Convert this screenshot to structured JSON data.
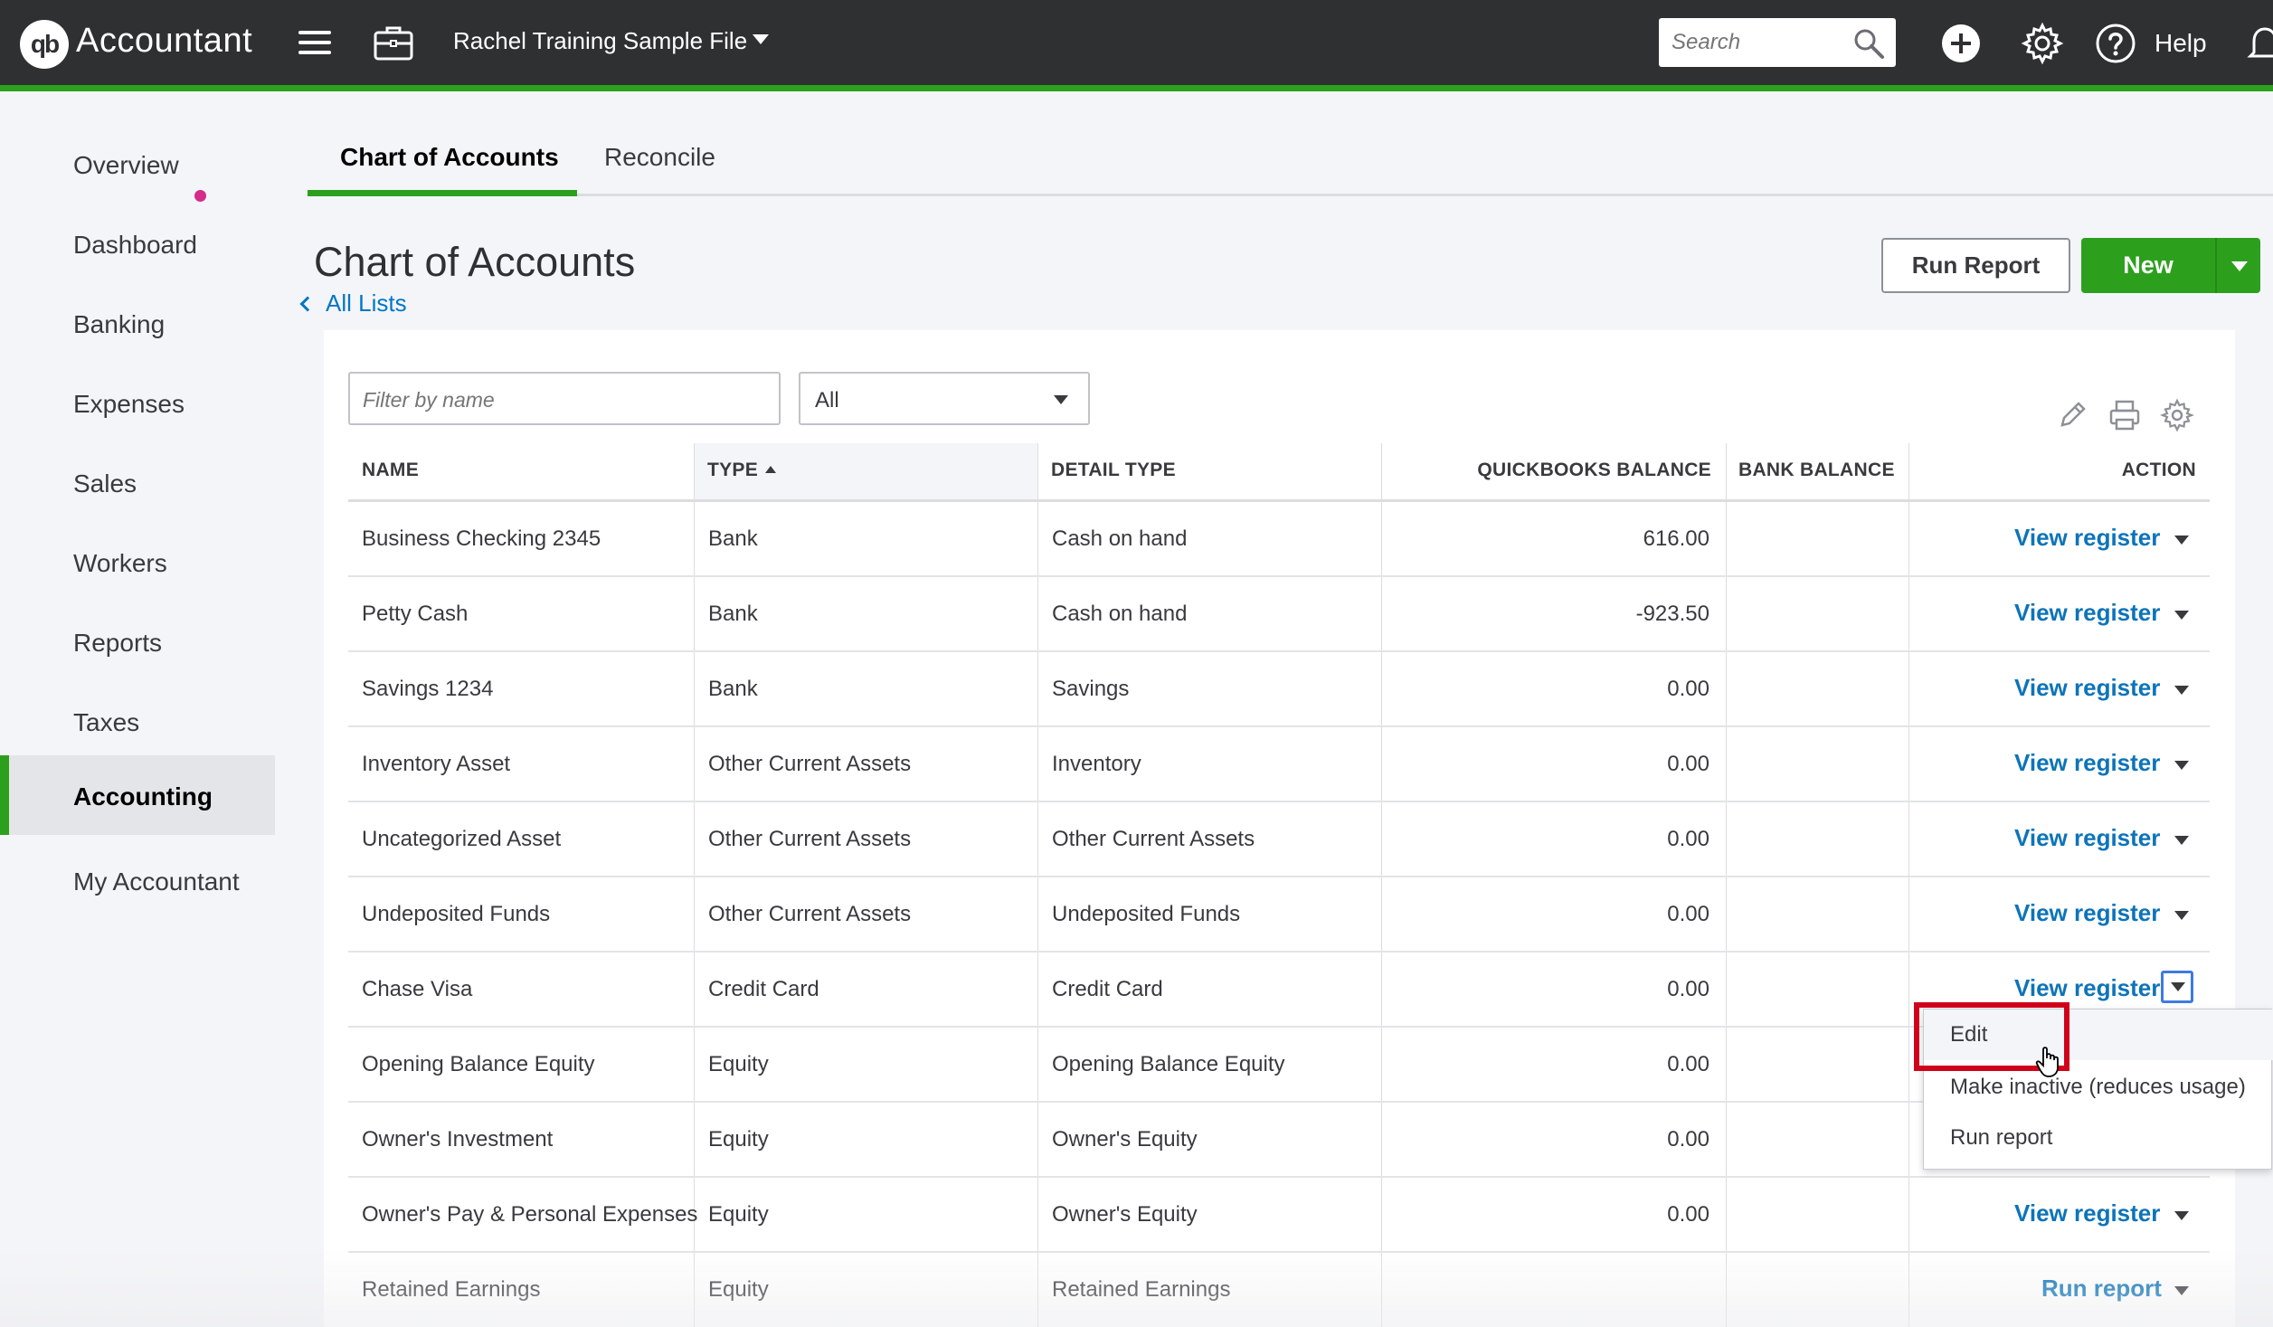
{
  "topbar": {
    "logo_mark": "qb",
    "app_name": "Accountant",
    "company_name": "Rachel Training Sample File",
    "search_placeholder": "Search",
    "help_label": "Help",
    "icons": [
      "menu-icon",
      "briefcase-icon",
      "search-icon",
      "plus-circle-icon",
      "gear-icon",
      "help-circle-icon",
      "bell-icon"
    ]
  },
  "sidebar": {
    "items": [
      {
        "label": "Overview",
        "badge": true
      },
      {
        "label": "Dashboard"
      },
      {
        "label": "Banking"
      },
      {
        "label": "Expenses"
      },
      {
        "label": "Sales"
      },
      {
        "label": "Workers"
      },
      {
        "label": "Reports"
      },
      {
        "label": "Taxes"
      },
      {
        "label": "Accounting",
        "active": true
      },
      {
        "label": "My Accountant"
      }
    ]
  },
  "tabs": [
    {
      "label": "Chart of Accounts",
      "active": true
    },
    {
      "label": "Reconcile"
    }
  ],
  "header": {
    "title": "Chart of Accounts",
    "back_link": "All Lists",
    "run_report_label": "Run Report",
    "new_label": "New"
  },
  "filters": {
    "name_placeholder": "Filter by name",
    "type_value": "All"
  },
  "table": {
    "columns": [
      "NAME",
      "TYPE",
      "DETAIL TYPE",
      "QUICKBOOKS BALANCE",
      "BANK BALANCE",
      "ACTION"
    ],
    "sorted_by": "TYPE",
    "rows": [
      {
        "name": "Business Checking 2345",
        "type": "Bank",
        "detail": "Cash on hand",
        "qb_balance": "616.00",
        "bank_balance": "",
        "action": "View register"
      },
      {
        "name": "Petty Cash",
        "type": "Bank",
        "detail": "Cash on hand",
        "qb_balance": "-923.50",
        "bank_balance": "",
        "action": "View register"
      },
      {
        "name": "Savings 1234",
        "type": "Bank",
        "detail": "Savings",
        "qb_balance": "0.00",
        "bank_balance": "",
        "action": "View register"
      },
      {
        "name": "Inventory Asset",
        "type": "Other Current Assets",
        "detail": "Inventory",
        "qb_balance": "0.00",
        "bank_balance": "",
        "action": "View register"
      },
      {
        "name": "Uncategorized Asset",
        "type": "Other Current Assets",
        "detail": "Other Current Assets",
        "qb_balance": "0.00",
        "bank_balance": "",
        "action": "View register"
      },
      {
        "name": "Undeposited Funds",
        "type": "Other Current Assets",
        "detail": "Undeposited Funds",
        "qb_balance": "0.00",
        "bank_balance": "",
        "action": "View register"
      },
      {
        "name": "Chase Visa",
        "type": "Credit Card",
        "detail": "Credit Card",
        "qb_balance": "0.00",
        "bank_balance": "",
        "action": "View register"
      },
      {
        "name": "Opening Balance Equity",
        "type": "Equity",
        "detail": "Opening Balance Equity",
        "qb_balance": "0.00",
        "bank_balance": "",
        "action": ""
      },
      {
        "name": "Owner's Investment",
        "type": "Equity",
        "detail": "Owner's Equity",
        "qb_balance": "0.00",
        "bank_balance": "",
        "action": ""
      },
      {
        "name": "Owner's Pay & Personal Expenses",
        "type": "Equity",
        "detail": "Owner's Equity",
        "qb_balance": "0.00",
        "bank_balance": "",
        "action": "View register"
      },
      {
        "name": "Retained Earnings",
        "type": "Equity",
        "detail": "Retained Earnings",
        "qb_balance": "",
        "bank_balance": "",
        "action": "Run report"
      }
    ]
  },
  "action_menu": {
    "items": [
      "Edit",
      "Make inactive (reduces usage)",
      "Run report"
    ],
    "highlighted": "Edit"
  },
  "colors": {
    "brand_green": "#2ca01c",
    "topbar": "#2e3032",
    "link_blue": "#0d74b9",
    "highlight_red": "#d0021b",
    "overview_dot": "#d52b8a"
  }
}
